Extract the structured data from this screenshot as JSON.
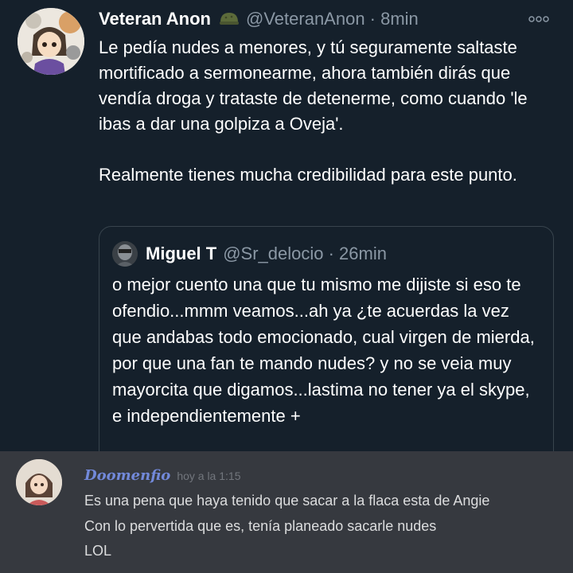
{
  "tweet": {
    "author_name": "Veteran Anon",
    "handle_time": "@VeteranAnon · 8min",
    "more_icon": "more-options-icon",
    "paragraph_1": "Le pedía nudes a menores, y tú seguramente saltaste mortificado a sermonearme, ahora también dirás que vendía droga y trataste de detenerme, como cuando 'le ibas a dar una golpiza a Oveja'.",
    "paragraph_2": "Realmente tienes mucha credibilidad para este punto."
  },
  "quote_tweet": {
    "author_name": "Miguel T",
    "handle_time": "@Sr_delocio · 26min",
    "text": "o mejor cuento una que tu mismo me dijiste si eso te ofendio...mmm veamos...ah ya ¿te acuerdas la vez que andabas todo emocionado, cual virgen de mierda, por que una fan te mando nudes? y no se veia muy mayorcita que digamos...lastima no tener ya el skype, e independientemente +"
  },
  "discord_message": {
    "username": "Doomenfio",
    "timestamp": "hoy a la 1:15",
    "lines": [
      "Es una pena que haya tenido que sacar a la flaca esta de Angie",
      "Con lo pervertida que es, tenía planeado sacarle nudes",
      "LOL"
    ]
  },
  "colors": {
    "tweet_background": "#15202b",
    "secondary_text": "#8b98a5",
    "discord_background": "#36393f",
    "discord_username": "#7289da"
  }
}
